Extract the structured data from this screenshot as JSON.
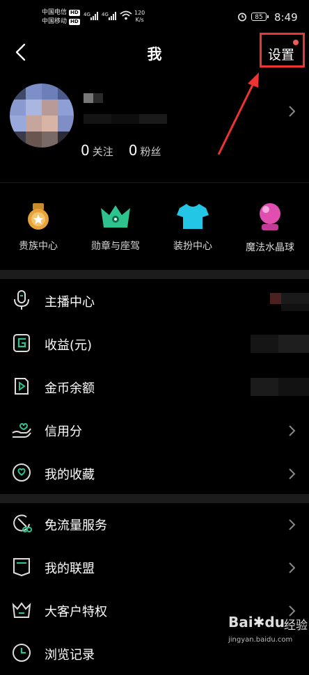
{
  "status_bar": {
    "carrier1": "中国电信",
    "carrier2": "中国移动",
    "hd": "HD",
    "signal_type": "4G",
    "speed_value": "120",
    "speed_unit": "K/s",
    "battery": "85",
    "time": "8:49"
  },
  "header": {
    "title": "我",
    "settings_label": "设置"
  },
  "profile": {
    "following_count": "0",
    "following_label": "关注",
    "fans_count": "0",
    "fans_label": "粉丝"
  },
  "quick_actions": [
    {
      "label": "贵族中心",
      "icon": "noble-medal-icon"
    },
    {
      "label": "勋章与座驾",
      "icon": "crown-icon"
    },
    {
      "label": "装扮中心",
      "icon": "tshirt-icon"
    },
    {
      "label": "魔法水晶球",
      "icon": "crystal-ball-icon"
    }
  ],
  "menu_group1": [
    {
      "label": "主播中心",
      "icon": "microphone-icon"
    },
    {
      "label": "收益(元)",
      "icon": "earnings-icon"
    },
    {
      "label": "金币余额",
      "icon": "coin-balance-icon"
    },
    {
      "label": "信用分",
      "icon": "credit-hand-heart-icon"
    },
    {
      "label": "我的收藏",
      "icon": "heart-circle-icon"
    }
  ],
  "menu_group2": [
    {
      "label": "免流量服务",
      "icon": "data-free-icon"
    },
    {
      "label": "我的联盟",
      "icon": "alliance-icon"
    },
    {
      "label": "大客户特权",
      "icon": "vip-privilege-icon"
    },
    {
      "label": "浏览记录",
      "icon": "history-clock-icon"
    }
  ],
  "watermark": {
    "brand": "Bai",
    "brand_end": "du",
    "jingyan": "经验",
    "url": "jingyan.baidu.com"
  },
  "colors": {
    "background": "#000000",
    "accent_green": "#2ec28c",
    "annotation_red": "#e33333"
  }
}
